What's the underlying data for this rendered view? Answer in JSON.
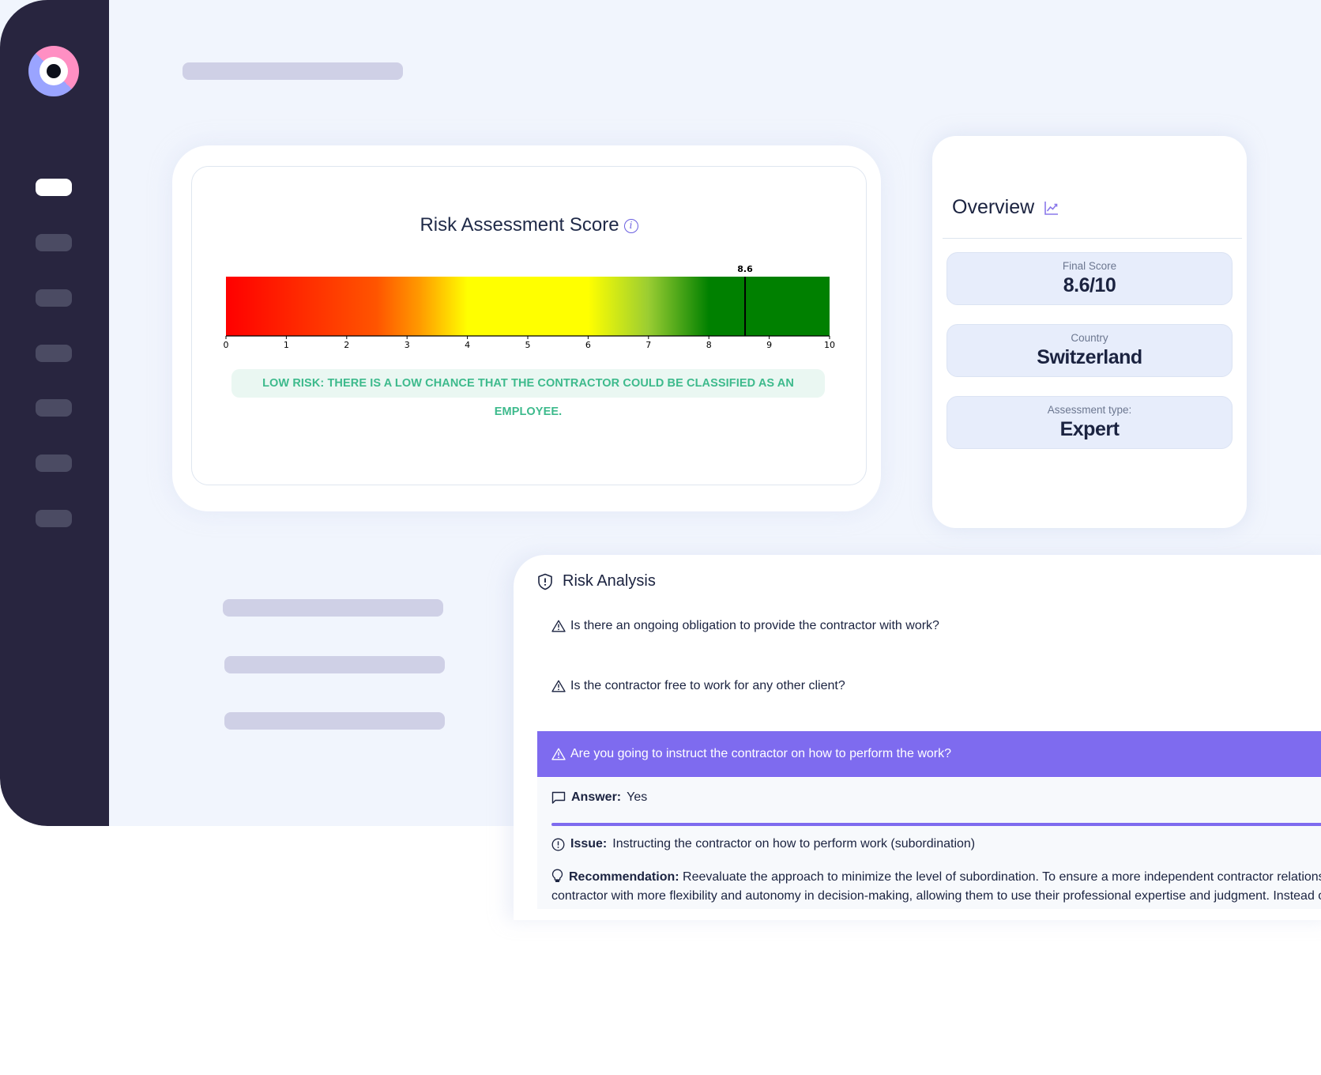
{
  "sidebar": {
    "logo": "eye-logo",
    "nav_items": [
      {
        "name": "nav-item-1",
        "active": true
      },
      {
        "name": "nav-item-2",
        "active": false
      },
      {
        "name": "nav-item-3",
        "active": false
      },
      {
        "name": "nav-item-4",
        "active": false
      },
      {
        "name": "nav-item-5",
        "active": false
      },
      {
        "name": "nav-item-6",
        "active": false
      },
      {
        "name": "nav-item-7",
        "active": false
      }
    ]
  },
  "score_card": {
    "title": "Risk Assessment Score",
    "info_icon": "i",
    "risk_message": "LOW RISK: THERE IS A LOW CHANCE THAT THE CONTRACTOR COULD BE CLASSIFIED AS AN EMPLOYEE.",
    "risk_color": "#3dba8c"
  },
  "chart_data": {
    "type": "gauge",
    "title": "Risk Assessment Score",
    "value": 8.6,
    "value_label": "8.6",
    "xlim": [
      0,
      10
    ],
    "ticks": [
      "0",
      "1",
      "2",
      "3",
      "4",
      "5",
      "6",
      "7",
      "8",
      "9",
      "10"
    ],
    "color_stops": [
      {
        "at": 0,
        "color": "#ff0000"
      },
      {
        "at": 2.5,
        "color": "#ff5500"
      },
      {
        "at": 3.2,
        "color": "#ff9900"
      },
      {
        "at": 4.0,
        "color": "#ffff00"
      },
      {
        "at": 6.0,
        "color": "#ffff00"
      },
      {
        "at": 7.0,
        "color": "#9acd32"
      },
      {
        "at": 8.0,
        "color": "#008000"
      },
      {
        "at": 10,
        "color": "#008000"
      }
    ]
  },
  "overview": {
    "title": "Overview",
    "stats": [
      {
        "label": "Final Score",
        "value": "8.6/10"
      },
      {
        "label": "Country",
        "value": "Switzerland"
      },
      {
        "label": "Assessment type:",
        "value": "Expert"
      }
    ]
  },
  "risk_analysis": {
    "title": "Risk Analysis",
    "questions": [
      {
        "text": "Is there an ongoing obligation to provide the contractor with work?",
        "selected": false
      },
      {
        "text": "Is the contractor free to work for any other client?",
        "selected": false
      },
      {
        "text": "Are you going to instruct the contractor on how to perform the work?",
        "selected": true
      }
    ],
    "answer_label": "Answer:",
    "answer_value": "Yes",
    "issue_label": "Issue:",
    "issue_value": "Instructing the contractor on how to perform work (subordination)",
    "recommendation_label": "Recommendation:",
    "recommendation_line1": "Reevaluate the approach to minimize the level of subordination. To ensure a more independent contractor relationship, provide the",
    "recommendation_line2": "contractor with more flexibility and autonomy in decision-making, allowing them to use their professional expertise and judgment. Instead of specifying"
  },
  "colors": {
    "sidebar": "#28253f",
    "accent": "#7e6bef",
    "background": "#f1f5fd"
  }
}
